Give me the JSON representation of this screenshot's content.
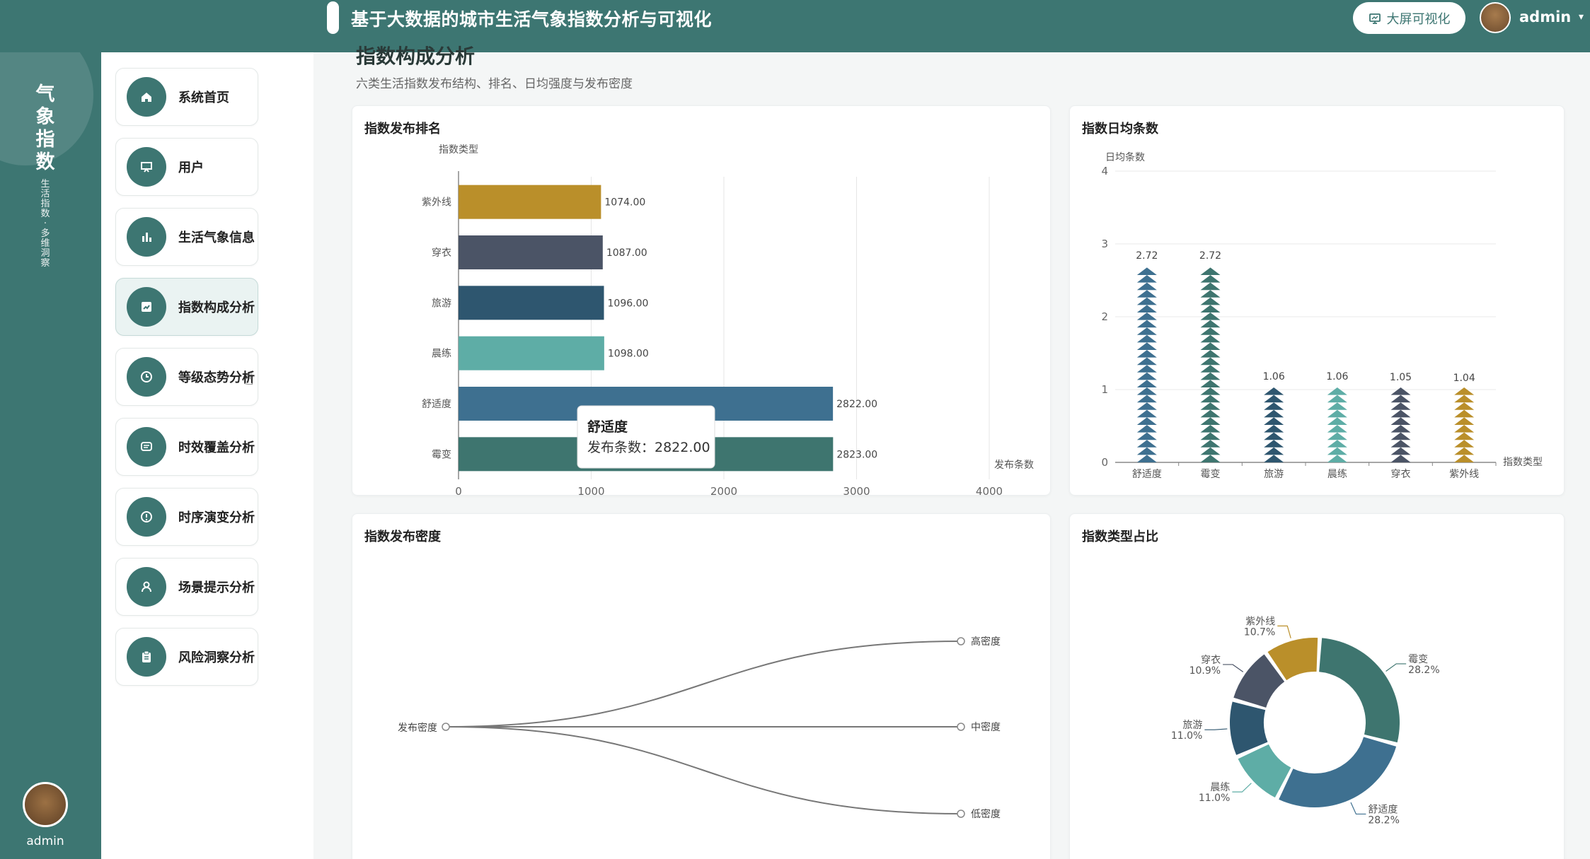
{
  "header": {
    "title": "基于大数据的城市生活气象指数分析与可视化",
    "screen_button": "大屏可视化",
    "screen_icon": "monitor-icon",
    "user": "admin"
  },
  "rail": {
    "brand": [
      "气",
      "象",
      "指",
      "数"
    ],
    "sub": [
      "生",
      "活",
      "指",
      "数",
      "·",
      "多",
      "维",
      "洞",
      "察"
    ],
    "user": "admin"
  },
  "menu": [
    {
      "label": "系统首页",
      "icon": "home-icon"
    },
    {
      "label": "用户",
      "icon": "presentation-icon"
    },
    {
      "label": "生活气象信息",
      "icon": "bar-chart-icon"
    },
    {
      "label": "指数构成分析",
      "icon": "chart-icon",
      "active": true
    },
    {
      "label": "等级态势分析",
      "icon": "clock-icon"
    },
    {
      "label": "时效覆盖分析",
      "icon": "message-icon"
    },
    {
      "label": "时序演变分析",
      "icon": "alert-icon"
    },
    {
      "label": "场景提示分析",
      "icon": "user-icon"
    },
    {
      "label": "风险洞察分析",
      "icon": "clipboard-icon"
    }
  ],
  "page": {
    "title": "指数构成分析",
    "subtitle": "六类生活指数发布结构、排名、日均强度与发布密度"
  },
  "colors": {
    "primary": "#3d7672",
    "霉变": "#3e756f",
    "舒适度": "#3e7090",
    "晨练": "#5eada6",
    "旅游": "#2e566f",
    "穿衣": "#4b5466",
    "紫外线": "#ba8f2a"
  },
  "chart_data": [
    {
      "type": "bar",
      "orientation": "horizontal",
      "title": "指数发布排名",
      "ylabel": "指数类型",
      "xlabel": "发布条数",
      "categories": [
        "紫外线",
        "穿衣",
        "旅游",
        "晨练",
        "舒适度",
        "霉变"
      ],
      "values": [
        1074,
        1087,
        1096,
        1098,
        2822,
        2823
      ],
      "value_labels": [
        "1074.00",
        "1087.00",
        "1096.00",
        "1098.00",
        "2822.00",
        "2823.00"
      ],
      "xlim": [
        0,
        4000
      ],
      "xticks": [
        "0",
        "1000",
        "2000",
        "3000",
        "4000"
      ],
      "grid": true,
      "tooltip": {
        "title": "舒适度",
        "text": "发布条数：2822.00"
      }
    },
    {
      "type": "bar",
      "style": "pictorial-triangles",
      "title": "指数日均条数",
      "ylabel": "日均条数",
      "xlabel": "指数类型",
      "categories": [
        "舒适度",
        "霉变",
        "旅游",
        "晨练",
        "穿衣",
        "紫外线"
      ],
      "values": [
        2.72,
        2.72,
        1.06,
        1.06,
        1.05,
        1.04
      ],
      "value_labels": [
        "2.72",
        "2.72",
        "1.06",
        "1.06",
        "1.05",
        "1.04"
      ],
      "ylim": [
        0,
        4
      ],
      "yticks": [
        "0",
        "1",
        "2",
        "3",
        "4"
      ],
      "grid": true
    },
    {
      "type": "tree",
      "title": "指数发布密度",
      "root": "发布密度",
      "children": [
        "高密度",
        "中密度",
        "低密度"
      ]
    },
    {
      "type": "pie",
      "style": "donut",
      "title": "指数类型占比",
      "labels": [
        "霉变",
        "舒适度",
        "晨练",
        "旅游",
        "穿衣",
        "紫外线"
      ],
      "values": [
        28.2,
        28.2,
        11.0,
        11.0,
        10.9,
        10.7
      ],
      "percent_labels": [
        "28.2%",
        "28.2%",
        "11.0%",
        "11.0%",
        "10.9%",
        "10.7%"
      ]
    }
  ]
}
